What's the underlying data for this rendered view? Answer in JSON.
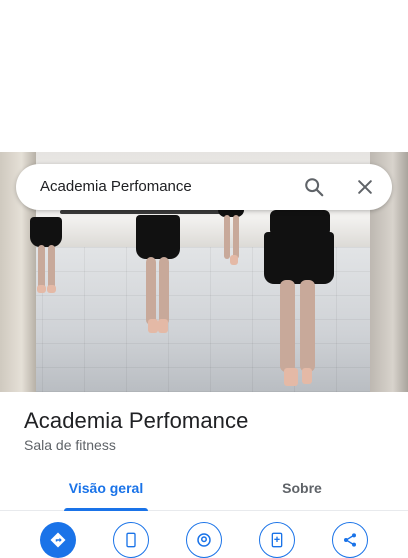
{
  "search": {
    "query": "Academia Perfomance",
    "search_icon": "search-icon",
    "close_icon": "close-icon"
  },
  "place": {
    "name": "Academia Perfomance",
    "category": "Sala de fitness"
  },
  "tabs": [
    {
      "label": "Visão geral",
      "active": true
    },
    {
      "label": "Sobre",
      "active": false
    }
  ],
  "actions": [
    {
      "icon": "directions-icon",
      "primary": true
    },
    {
      "icon": "phone-icon",
      "primary": false
    },
    {
      "icon": "location-icon",
      "primary": false
    },
    {
      "icon": "add-phone-icon",
      "primary": false
    },
    {
      "icon": "share-icon",
      "primary": false
    }
  ],
  "colors": {
    "accent": "#1a73e8",
    "title_text": "#202124",
    "secondary_text": "#5f6368"
  }
}
